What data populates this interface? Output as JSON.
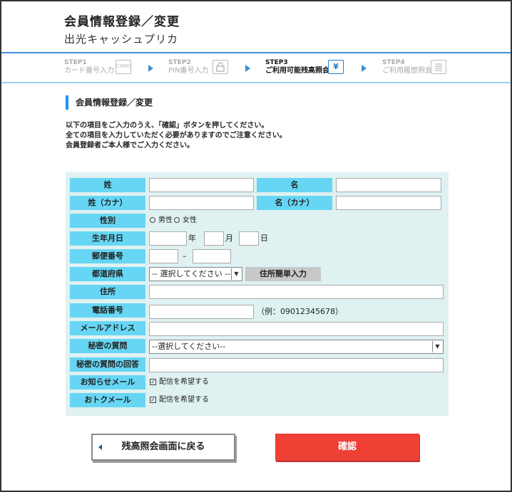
{
  "header": {
    "title": "会員情報登録／変更",
    "subtitle": "出光キャッシュプリカ"
  },
  "steps": [
    {
      "num": "STEP1",
      "label": "カード番号入力",
      "icon": "card-icon",
      "icon_text": "CARD",
      "active": false
    },
    {
      "num": "STEP2",
      "label": "PIN番号入力",
      "icon": "lock-icon",
      "icon_text": "",
      "active": false
    },
    {
      "num": "STEP3",
      "label": "ご利用可能残高照会",
      "icon": "yen-icon",
      "icon_text": "¥",
      "active": true
    },
    {
      "num": "STEP4",
      "label": "ご利用履歴照会",
      "icon": "list-icon",
      "icon_text": "",
      "active": false
    }
  ],
  "section": {
    "title": "会員情報登録／変更",
    "intro": [
      "以下の項目をご入力のうえ、「確認」ボタンを押してください。",
      "全ての項目を入力していただく必要がありますのでご注意ください。",
      "会員登録者ご本人様でご入力ください。"
    ]
  },
  "form": {
    "sei_label": "姓",
    "mei_label": "名",
    "sei_kana_label": "姓（カナ）",
    "mei_kana_label": "名（カナ）",
    "gender_label": "性別",
    "gender_male": "男性",
    "gender_female": "女性",
    "birth_label": "生年月日",
    "year_unit": "年",
    "month_unit": "月",
    "day_unit": "日",
    "postal_label": "郵便番号",
    "postal_sep": "–",
    "pref_label": "都道府県",
    "pref_selected": "-- 選択してください --",
    "address_button": "住所簡単入力",
    "address_label": "住所",
    "phone_label": "電話番号",
    "phone_example": "（例：09012345678）",
    "email_label": "メールアドレス",
    "secret_q_label": "秘密の質問",
    "secret_q_selected": "--選択してください--",
    "secret_a_label": "秘密の質問の回答",
    "notice_mail_label": "お知らせメール",
    "notice_mail_option": "配信を希望する",
    "deal_mail_label": "おトクメール",
    "deal_mail_option": "配信を希望する"
  },
  "buttons": {
    "back": "残高照会画面に戻る",
    "confirm": "確認"
  },
  "colors": {
    "label_bg": "#66d6f4",
    "form_bg": "#dff1f1",
    "accent": "#3c8fd6",
    "confirm_bg": "#ee4035"
  }
}
